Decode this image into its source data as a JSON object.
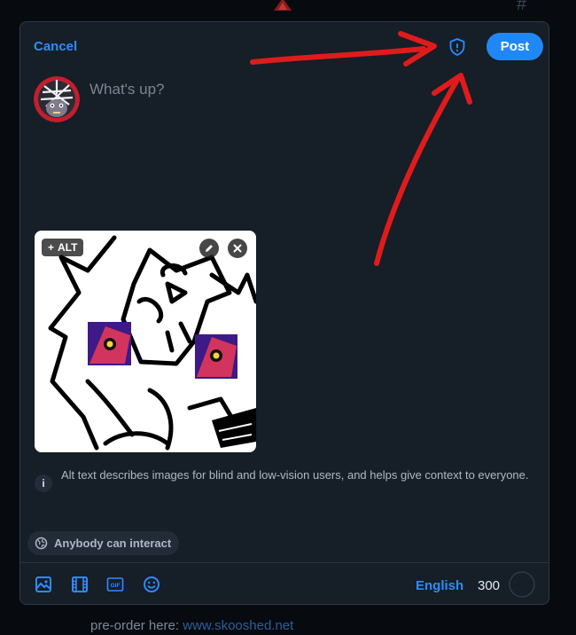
{
  "background": {
    "hash_icon": "#",
    "footer_prefix": "pre-order here:",
    "footer_link": "www.skooshed.net"
  },
  "header": {
    "cancel_label": "Cancel",
    "post_label": "Post",
    "threadgate_icon": "shield-alert-icon"
  },
  "composer": {
    "placeholder": "What's up?"
  },
  "media": {
    "alt_plus": "+",
    "alt_label": "ALT"
  },
  "alt_info": {
    "icon": "i",
    "text": "Alt text describes images for blind and low-vision users, and helps give context to everyone."
  },
  "interaction": {
    "label": "Anybody can interact"
  },
  "toolbar": {
    "tools": [
      "image-icon",
      "video-icon",
      "gif-icon",
      "emoji-icon"
    ],
    "gif_text": "GIF",
    "language": "English",
    "char_count": "300"
  },
  "colors": {
    "accent": "#2088f5",
    "annotation": "#e01b1b",
    "modal_bg": "#161e27"
  }
}
